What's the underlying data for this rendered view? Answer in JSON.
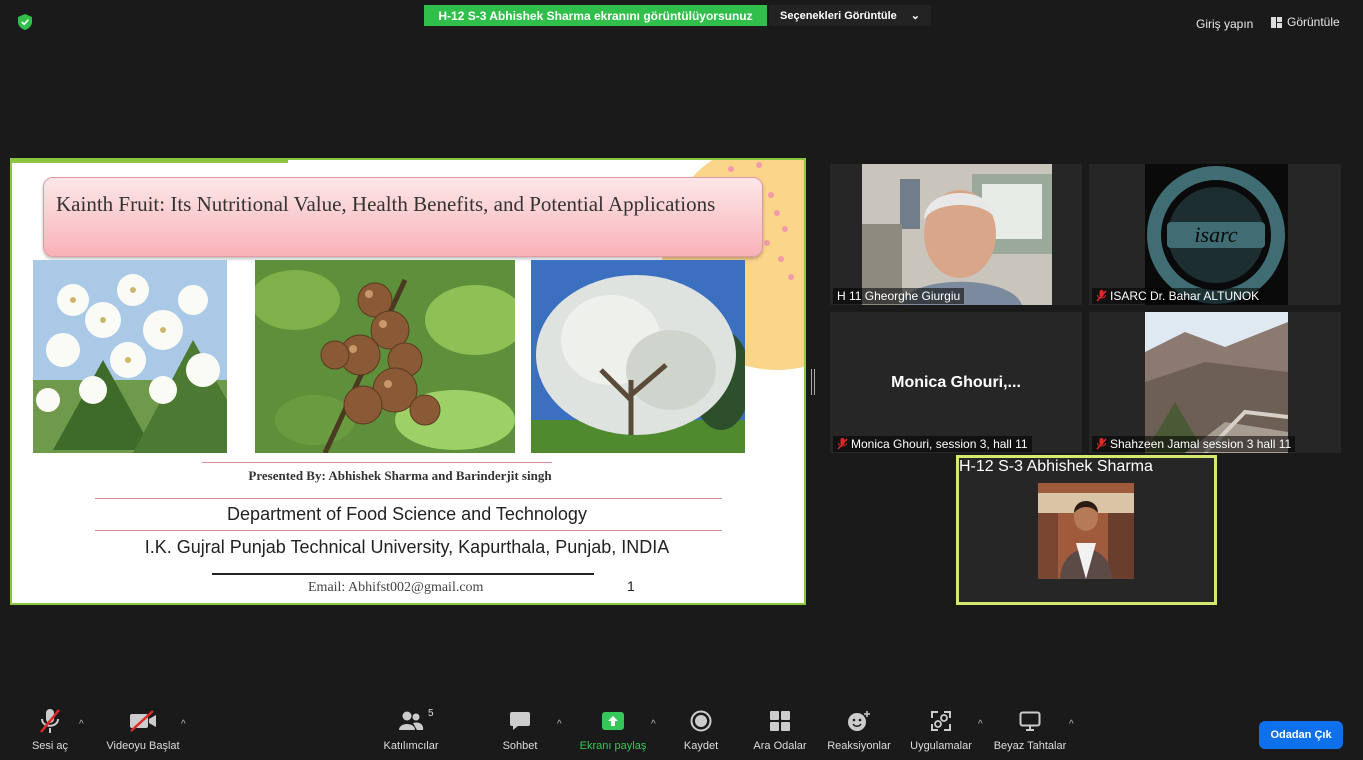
{
  "top_bar": {
    "share_banner": "H-12 S-3 Abhishek Sharma ekranını görüntülüyorsunuz",
    "options_label": "Seçenekleri Görüntüle",
    "options_caret": "⌄",
    "signin": "Giriş yapın",
    "view": "Görüntüle"
  },
  "slide": {
    "title": "Kainth Fruit: Its Nutritional Value, Health Benefits, and Potential Applications",
    "presented_by": "Presented By: Abhishek Sharma and Barinderjit singh",
    "department": "Department of Food Science and Technology",
    "university": "I.K. Gujral Punjab Technical University, Kapurthala, Punjab, INDIA",
    "email": "Email: Abhifst002@gmail.com",
    "page_number": "1"
  },
  "participants": {
    "tile1_label": "H 11 Gheorghe Giurgiu",
    "tile2_label": "ISARC Dr. Bahar ALTUNOK",
    "tile2_logo": "isarc",
    "tile3_name": "Monica  Ghouri,...",
    "tile3_label": "Monica Ghouri, session 3, hall 11",
    "tile4_label": "Shahzeen Jamal session 3 hall 11",
    "active_label": "H-12 S-3 Abhishek Sharma"
  },
  "toolbar": {
    "mute": "Sesi aç",
    "video": "Videoyu Başlat",
    "participants": "Katılımcılar",
    "participants_count": "5",
    "chat": "Sohbet",
    "share": "Ekranı paylaş",
    "record": "Kaydet",
    "breakout": "Ara Odalar",
    "reactions": "Reaksiyonlar",
    "apps": "Uygulamalar",
    "whiteboard": "Beyaz Tahtalar",
    "leave": "Odadan Çık",
    "caret": "^"
  },
  "colors": {
    "share_green": "#2fbf4a",
    "active_border": "#d7e86f",
    "leave_blue": "#0e71eb",
    "mute_red": "#e02828"
  }
}
